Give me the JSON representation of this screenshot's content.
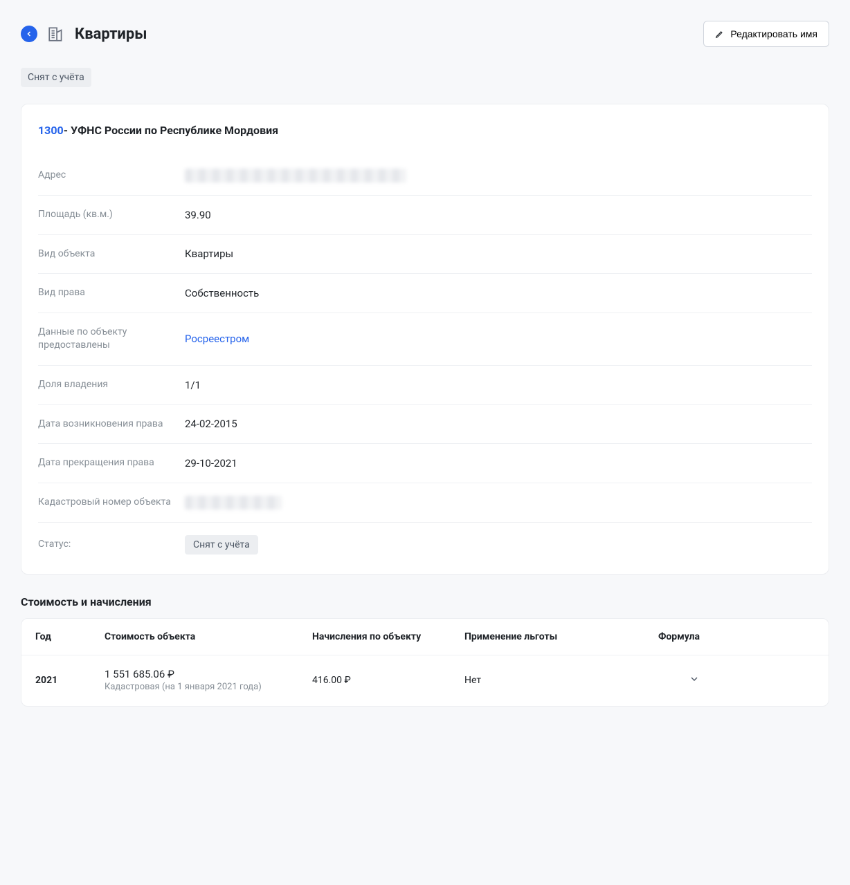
{
  "header": {
    "title": "Квартиры",
    "edit_button": "Редактировать имя"
  },
  "status_badge": "Снят с учёта",
  "card": {
    "code": "1300",
    "title_rest": "- УФНС России по Республике Мордовия",
    "rows": {
      "address_label": "Адрес",
      "area_label": "Площадь (кв.м.)",
      "area_value": "39.90",
      "object_type_label": "Вид объекта",
      "object_type_value": "Квартиры",
      "right_type_label": "Вид права",
      "right_type_value": "Собственность",
      "provided_by_label": "Данные по объекту предоставлены",
      "provided_by_value": "Росреестром",
      "ownership_share_label": "Доля владения",
      "ownership_share_value": "1/1",
      "right_start_label": "Дата возникновения права",
      "right_start_value": "24-02-2015",
      "right_end_label": "Дата прекращения права",
      "right_end_value": "29-10-2021",
      "cadastral_label": "Кадастровый номер объекта",
      "status_label": "Статус:",
      "status_value": "Снят с учёта"
    }
  },
  "cost_section": {
    "title": "Стоимость и начисления",
    "columns": {
      "year": "Год",
      "cost": "Стоимость объекта",
      "charges": "Начисления по объекту",
      "benefit": "Применение льготы",
      "formula": "Формула"
    },
    "rows": [
      {
        "year": "2021",
        "cost_main": "1 551 685.06 ₽",
        "cost_sub": "Кадастровая (на 1 января 2021 года)",
        "charges": "416.00 ₽",
        "benefit": "Нет"
      }
    ]
  }
}
